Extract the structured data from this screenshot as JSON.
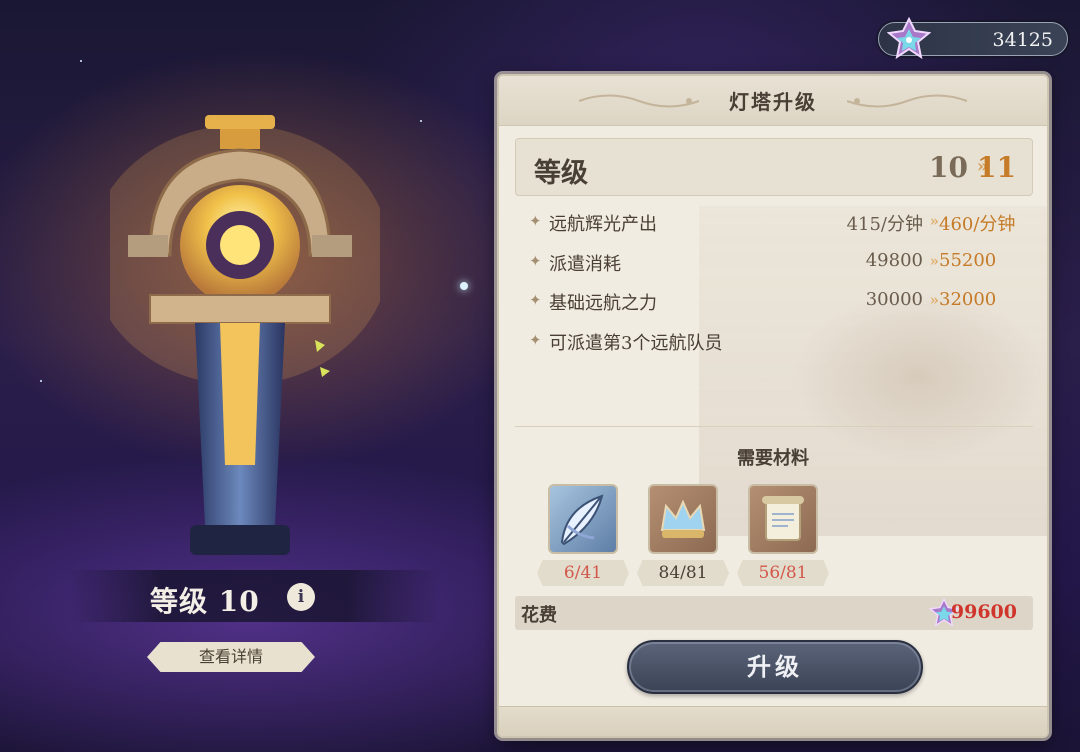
{
  "currency": {
    "amount": "34125",
    "icon": "star-gem-icon"
  },
  "tower": {
    "level_label": "等级 10",
    "info_label": "i",
    "detail_button": "查看详情"
  },
  "panel": {
    "title": "灯塔升级",
    "level": {
      "label": "等级",
      "from": "10",
      "arrow": "»",
      "to": "11"
    },
    "stats": [
      {
        "label": "远航辉光产出",
        "from": "415/分钟",
        "to": "460/分钟"
      },
      {
        "label": "派遣消耗",
        "from": "49800",
        "to": "55200"
      },
      {
        "label": "基础远航之力",
        "from": "30000",
        "to": "32000"
      },
      {
        "label": "可派遣第3个远航队员",
        "from": "",
        "to": ""
      }
    ],
    "stat_arrow": "»",
    "stat_bullet": "✦",
    "materials_title": "需要材料",
    "materials": [
      {
        "icon": "quill-feather-icon",
        "count": "6/41"
      },
      {
        "icon": "crown-icon",
        "count": "84/81"
      },
      {
        "icon": "scroll-icon",
        "count": "56/81"
      }
    ],
    "cost": {
      "label": "花费",
      "value": "99600",
      "icon": "star-gem-icon"
    },
    "upgrade_button": "升级"
  },
  "colors": {
    "accent": "#c57b28",
    "shortage": "#d2574a",
    "cost": "#d0352c"
  }
}
